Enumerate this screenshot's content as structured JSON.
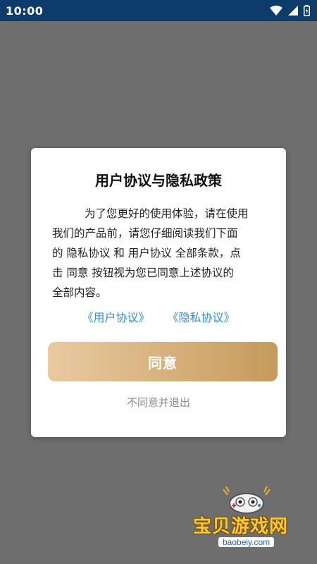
{
  "status_bar": {
    "time": "10:00",
    "icons": [
      "wifi-icon",
      "signal-icon",
      "battery-icon"
    ]
  },
  "dialog": {
    "title": "用户协议与隐私政策",
    "body_line1": "为了您更好的使用体验，请在使用",
    "body_line2": "我们的产品前，请您仔细阅读我们下面",
    "body_line3": "的 隐私协议 和 用户协议 全部条款，点",
    "body_line4": "击 同意 按钮视为您已同意上述协议的",
    "body_line5": "全部内容。",
    "link_user_agreement": "《用户协议》",
    "link_privacy_policy": "《隐私协议》",
    "agree_label": "同意",
    "decline_label": "不同意并退出"
  },
  "watermark": {
    "site_name": "宝贝游戏网",
    "site_url": "baobeiy.com"
  },
  "colors": {
    "status_bar": "#0d3c6a",
    "overlay": "#6e6e6e",
    "link": "#2f8de0",
    "button_start": "#e9caa0",
    "button_end": "#c59a5c",
    "decline_text": "#8a8a8a"
  }
}
